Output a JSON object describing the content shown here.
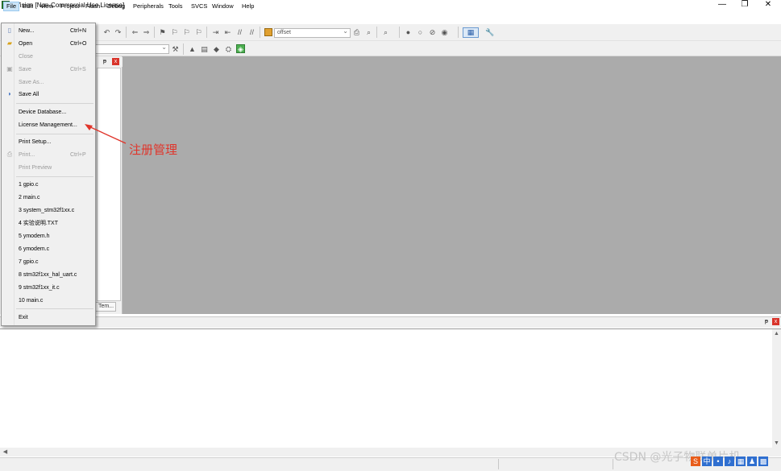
{
  "window": {
    "title": "µVision  [Non-Commercial Use License]",
    "minimize": "—",
    "restore": "❐",
    "close": "✕"
  },
  "menubar": {
    "items": [
      {
        "label": "File",
        "active": true
      },
      {
        "label": "Edit"
      },
      {
        "label": "View"
      },
      {
        "label": "Project"
      },
      {
        "label": "Flash"
      },
      {
        "label": "Debug"
      },
      {
        "label": "Peripherals"
      },
      {
        "label": "Tools"
      },
      {
        "label": "SVCS"
      },
      {
        "label": "Window"
      },
      {
        "label": "Help"
      }
    ]
  },
  "toolbar": {
    "target_value": "offset"
  },
  "file_menu": {
    "items": [
      {
        "label": "New...",
        "accel": "Ctrl+N",
        "icon": "new-file-icon"
      },
      {
        "label": "Open",
        "accel": "Ctrl+O",
        "icon": "open-folder-icon"
      },
      {
        "label": "Close",
        "disabled": true
      },
      {
        "label": "Save",
        "accel": "Ctrl+S",
        "disabled": true,
        "icon": "save-icon"
      },
      {
        "label": "Save As...",
        "disabled": true
      },
      {
        "label": "Save All",
        "icon": "save-all-icon"
      },
      {
        "label": "Device Database..."
      },
      {
        "label": "License Management..."
      },
      {
        "label": "Print Setup..."
      },
      {
        "label": "Print...",
        "accel": "Ctrl+P",
        "disabled": true,
        "icon": "print-icon"
      },
      {
        "label": "Print Preview",
        "disabled": true
      },
      {
        "label": "1 gpio.c"
      },
      {
        "label": "2 main.c"
      },
      {
        "label": "3 system_stm32f1xx.c"
      },
      {
        "label": "4 实验说明.TXT"
      },
      {
        "label": "5 ymodem.h"
      },
      {
        "label": "6 ymodem.c"
      },
      {
        "label": "7 gpio.c"
      },
      {
        "label": "8 stm32f1xx_hal_uart.c"
      },
      {
        "label": "9 stm32f1xx_it.c"
      },
      {
        "label": "10 main.c"
      },
      {
        "label": "Exit"
      }
    ]
  },
  "project_panel": {
    "tab_label": "Tem...",
    "pin": "ᵽ",
    "close": "x"
  },
  "output": {
    "pin": "ᵽ",
    "close": "x"
  },
  "annotation": {
    "text": "注册管理",
    "color": "#e0352b"
  },
  "watermark": "CSDN @光子物联单片机"
}
